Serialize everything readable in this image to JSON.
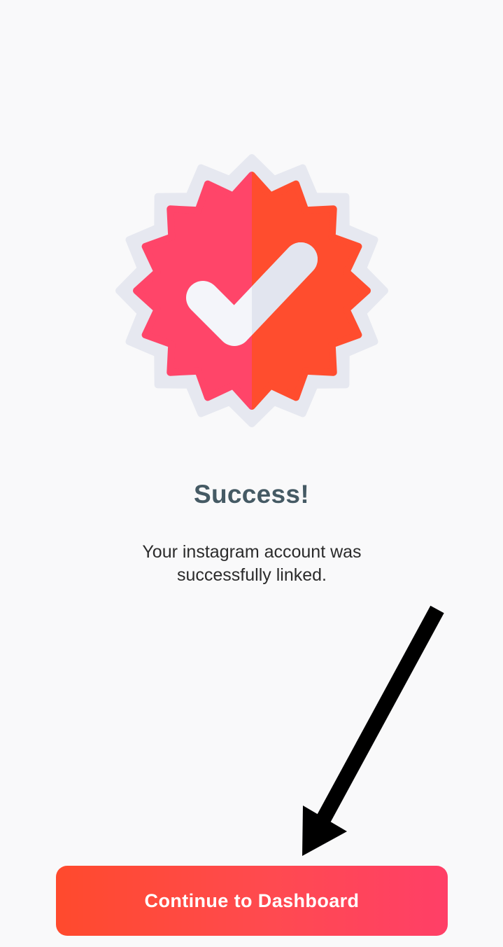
{
  "icons": {
    "badge": "verified-check-badge-icon",
    "annotation": "pointer-arrow-icon"
  },
  "colors": {
    "background": "#f9f9fa",
    "badge_left": "#ff4569",
    "badge_right": "#ff4d2e",
    "badge_outline": "#e6e8f0",
    "check": "#f4f5fa",
    "title": "#455a64",
    "button_gradient_start": "#ff4a2d",
    "button_gradient_end": "#ff3f67",
    "arrow": "#000000"
  },
  "success": {
    "title": "Success!",
    "message_line1": "Your instagram account was",
    "message_line2": "successfully linked."
  },
  "actions": {
    "continue_label": "Continue to Dashboard"
  }
}
